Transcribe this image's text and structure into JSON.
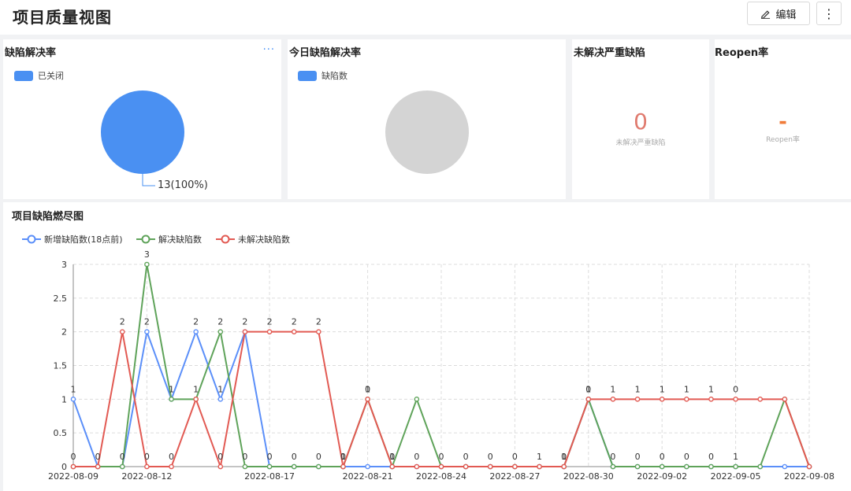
{
  "page": {
    "title": "项目质量视图",
    "edit_label": "编辑",
    "more_glyph": "⋮"
  },
  "cards": {
    "resolve_rate": {
      "title": "缺陷解决率",
      "more": "···",
      "legend": "已关闭",
      "slice_label": "13(100%)",
      "color": "#4a90f2"
    },
    "today_resolve": {
      "title": "今日缺陷解决率",
      "legend": "缺陷数",
      "color": "#d4d4d4"
    },
    "unresolved_severe": {
      "title": "未解决严重缺陷",
      "value": "0",
      "label": "未解决严重缺陷",
      "color": "#e07b6f"
    },
    "reopen": {
      "title": "Reopen率",
      "value": "-",
      "label": "Reopen率",
      "color": "#f07c3a"
    }
  },
  "burndown": {
    "title": "项目缺陷燃尽图"
  },
  "chart_data": {
    "type": "line",
    "title": "项目缺陷燃尽图",
    "x": [
      "2022-08-09",
      "2022-08-10",
      "2022-08-11",
      "2022-08-12",
      "2022-08-13",
      "2022-08-14",
      "2022-08-15",
      "2022-08-16",
      "2022-08-17",
      "2022-08-18",
      "2022-08-19",
      "2022-08-20",
      "2022-08-21",
      "2022-08-22",
      "2022-08-23",
      "2022-08-24",
      "2022-08-25",
      "2022-08-26",
      "2022-08-27",
      "2022-08-28",
      "2022-08-29",
      "2022-08-30",
      "2022-08-31",
      "2022-09-01",
      "2022-09-02",
      "2022-09-03",
      "2022-09-04",
      "2022-09-05",
      "2022-09-06",
      "2022-09-07",
      "2022-09-08"
    ],
    "x_tick_labels": [
      "2022-08-09",
      "2022-08-12",
      "2022-08-17",
      "2022-08-21",
      "2022-08-24",
      "2022-08-27",
      "2022-08-30",
      "2022-09-02",
      "2022-09-05",
      "2022-09-08"
    ],
    "ylim": [
      0,
      3
    ],
    "y_ticks": [
      "0",
      "0.5",
      "1",
      "1.5",
      "2",
      "2.5",
      "3"
    ],
    "grid": true,
    "legend_position": "top-left",
    "series": [
      {
        "name": "新增缺陷数(18点前)",
        "color": "#5b8ff9",
        "values": [
          1,
          0,
          0,
          2,
          1,
          2,
          1,
          2,
          0,
          0,
          0,
          0,
          0,
          0,
          0,
          0,
          0,
          0,
          0,
          0,
          0,
          1,
          0,
          0,
          0,
          0,
          0,
          0,
          0,
          0,
          0
        ]
      },
      {
        "name": "解决缺陷数",
        "color": "#5fa35a",
        "values": [
          0,
          0,
          0,
          3,
          1,
          1,
          2,
          0,
          0,
          0,
          0,
          0,
          1,
          0,
          1,
          0,
          0,
          0,
          0,
          0,
          0,
          1,
          0,
          0,
          0,
          0,
          0,
          0,
          0,
          1,
          0
        ]
      },
      {
        "name": "未解决缺陷数",
        "color": "#e25a53",
        "values": [
          0,
          0,
          2,
          0,
          0,
          1,
          0,
          2,
          2,
          2,
          2,
          0,
          1,
          0,
          0,
          0,
          0,
          0,
          0,
          0,
          0,
          1,
          1,
          1,
          1,
          1,
          1,
          1,
          1,
          1,
          0
        ]
      }
    ],
    "point_labels": [
      {
        "i": 0,
        "text": "1",
        "ref": 0
      },
      {
        "i": 0,
        "text": "0",
        "ref": 2
      },
      {
        "i": 1,
        "text": "0",
        "ref": 0
      },
      {
        "i": 2,
        "text": "2",
        "ref": 2
      },
      {
        "i": 2,
        "text": "0",
        "ref": 0
      },
      {
        "i": 3,
        "text": "3",
        "ref": 1
      },
      {
        "i": 3,
        "text": "2",
        "ref": 0
      },
      {
        "i": 3,
        "text": "0",
        "ref": 2
      },
      {
        "i": 4,
        "text": "1",
        "ref": 1
      },
      {
        "i": 4,
        "text": "0",
        "ref": 2
      },
      {
        "i": 5,
        "text": "2",
        "ref": 0
      },
      {
        "i": 5,
        "text": "1",
        "ref": 2
      },
      {
        "i": 6,
        "text": "2",
        "ref": 1
      },
      {
        "i": 6,
        "text": "1",
        "ref": 0
      },
      {
        "i": 6,
        "text": "0",
        "ref": 2
      },
      {
        "i": 7,
        "text": "2",
        "ref": 2
      },
      {
        "i": 7,
        "text": "0",
        "ref": 1
      },
      {
        "i": 8,
        "text": "2",
        "ref": 2
      },
      {
        "i": 8,
        "text": "0",
        "ref": 0
      },
      {
        "i": 9,
        "text": "2",
        "ref": 2
      },
      {
        "i": 9,
        "text": "0",
        "ref": 0
      },
      {
        "i": 10,
        "text": "2",
        "ref": 2
      },
      {
        "i": 10,
        "text": "0",
        "ref": 0
      },
      {
        "i": 11,
        "text": "1",
        "ref": 1
      },
      {
        "i": 11,
        "text": "0",
        "ref": 0
      },
      {
        "i": 12,
        "text": "1",
        "ref": 2
      },
      {
        "i": 12,
        "text": "0",
        "ref": 1
      },
      {
        "i": 13,
        "text": "1",
        "ref": 1
      },
      {
        "i": 13,
        "text": "0",
        "ref": 2
      },
      {
        "i": 14,
        "text": "0",
        "ref": 0
      },
      {
        "i": 15,
        "text": "0",
        "ref": 0
      },
      {
        "i": 16,
        "text": "0",
        "ref": 0
      },
      {
        "i": 17,
        "text": "0",
        "ref": 0
      },
      {
        "i": 18,
        "text": "0",
        "ref": 0
      },
      {
        "i": 19,
        "text": "1",
        "ref": 2
      },
      {
        "i": 20,
        "text": "1",
        "ref": 2
      },
      {
        "i": 20,
        "text": "0",
        "ref": 1
      },
      {
        "i": 21,
        "text": "1",
        "ref": 2
      },
      {
        "i": 21,
        "text": "0",
        "ref": 1
      },
      {
        "i": 22,
        "text": "1",
        "ref": 2
      },
      {
        "i": 22,
        "text": "0",
        "ref": 1
      },
      {
        "i": 23,
        "text": "1",
        "ref": 2
      },
      {
        "i": 23,
        "text": "0",
        "ref": 1
      },
      {
        "i": 24,
        "text": "1",
        "ref": 2
      },
      {
        "i": 24,
        "text": "0",
        "ref": 1
      },
      {
        "i": 25,
        "text": "1",
        "ref": 2
      },
      {
        "i": 25,
        "text": "0",
        "ref": 1
      },
      {
        "i": 26,
        "text": "1",
        "ref": 2
      },
      {
        "i": 26,
        "text": "0",
        "ref": 1
      },
      {
        "i": 27,
        "text": "1",
        "ref": 1
      },
      {
        "i": 27,
        "text": "0",
        "ref": 2
      }
    ]
  }
}
